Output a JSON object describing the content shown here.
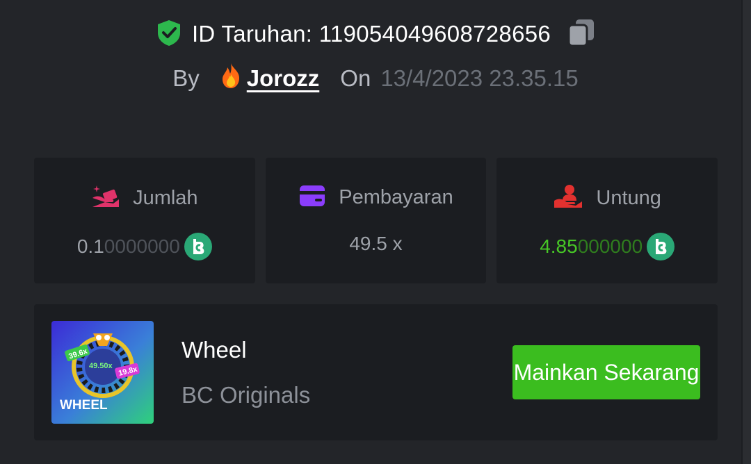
{
  "bet": {
    "id_label": "ID Taruhan:",
    "id_value": "119054049608728656",
    "by_label": "By",
    "user": "Jorozz",
    "on_label": "On",
    "date": "13/4/2023 23.35.15"
  },
  "stats": [
    {
      "title": "Jumlah",
      "value_main": "0.1",
      "value_dim": "0000000",
      "icon": "hand-money-icon",
      "coin": "bc-coin-icon"
    },
    {
      "title": "Pembayaran",
      "value": "49.5 x",
      "icon": "card-icon"
    },
    {
      "title": "Untung",
      "value_main": "4.85",
      "value_dim": "000000",
      "icon": "profit-hand-icon",
      "coin": "bc-coin-icon"
    }
  ],
  "game": {
    "name": "Wheel",
    "provider": "BC Originals",
    "play_label": "Mainkan Sekarang",
    "thumb_title": "WHEEL",
    "thumb_labels": [
      "39.6x",
      "49.50x",
      "19.8x"
    ]
  },
  "colors": {
    "background": "#232529",
    "card": "#1b1d21",
    "accent_green": "#3bbd1f",
    "profit_green": "#47c726",
    "coin": "#2aa876"
  }
}
